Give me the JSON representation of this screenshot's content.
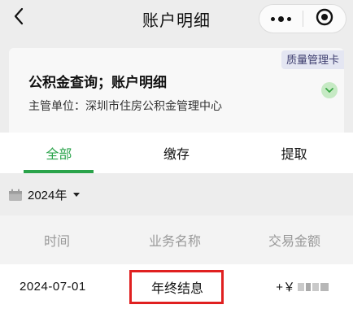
{
  "nav": {
    "title": "账户明细",
    "back_icon": "chevron-left-icon",
    "more_icon": "more-dots-icon",
    "close_icon": "target-close-icon"
  },
  "info_card": {
    "badge": "质量管理卡",
    "title": "公积金查询；账户明细",
    "subtitle": "主管单位：深圳市住房公积金管理中心",
    "expand_icon": "chevron-down-icon"
  },
  "tabs": [
    {
      "label": "全部",
      "active": true
    },
    {
      "label": "缴存",
      "active": false
    },
    {
      "label": "提取",
      "active": false
    }
  ],
  "filter": {
    "year": "2024年",
    "calendar_icon": "calendar-icon",
    "caret_icon": "caret-down-icon"
  },
  "table": {
    "headers": [
      "时间",
      "业务名称",
      "交易金额"
    ],
    "rows": [
      {
        "date": "2024-07-01",
        "business": "年终结息",
        "amount_prefix": "+￥",
        "amount_masked": true
      }
    ]
  },
  "colors": {
    "accent_green": "#2aa34a",
    "highlight_red": "#e02020",
    "badge_bg": "#e4e6f2"
  }
}
